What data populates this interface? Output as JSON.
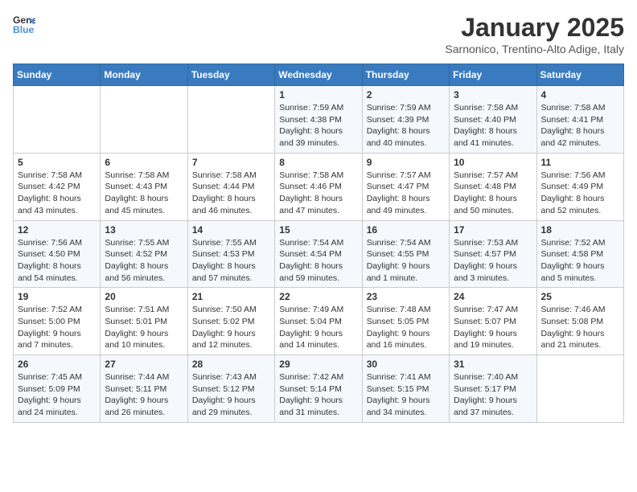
{
  "header": {
    "logo_line1": "General",
    "logo_line2": "Blue",
    "month": "January 2025",
    "location": "Sarnonico, Trentino-Alto Adige, Italy"
  },
  "days_of_week": [
    "Sunday",
    "Monday",
    "Tuesday",
    "Wednesday",
    "Thursday",
    "Friday",
    "Saturday"
  ],
  "weeks": [
    [
      {
        "day": "",
        "info": ""
      },
      {
        "day": "",
        "info": ""
      },
      {
        "day": "",
        "info": ""
      },
      {
        "day": "1",
        "info": "Sunrise: 7:59 AM\nSunset: 4:38 PM\nDaylight: 8 hours\nand 39 minutes."
      },
      {
        "day": "2",
        "info": "Sunrise: 7:59 AM\nSunset: 4:39 PM\nDaylight: 8 hours\nand 40 minutes."
      },
      {
        "day": "3",
        "info": "Sunrise: 7:58 AM\nSunset: 4:40 PM\nDaylight: 8 hours\nand 41 minutes."
      },
      {
        "day": "4",
        "info": "Sunrise: 7:58 AM\nSunset: 4:41 PM\nDaylight: 8 hours\nand 42 minutes."
      }
    ],
    [
      {
        "day": "5",
        "info": "Sunrise: 7:58 AM\nSunset: 4:42 PM\nDaylight: 8 hours\nand 43 minutes."
      },
      {
        "day": "6",
        "info": "Sunrise: 7:58 AM\nSunset: 4:43 PM\nDaylight: 8 hours\nand 45 minutes."
      },
      {
        "day": "7",
        "info": "Sunrise: 7:58 AM\nSunset: 4:44 PM\nDaylight: 8 hours\nand 46 minutes."
      },
      {
        "day": "8",
        "info": "Sunrise: 7:58 AM\nSunset: 4:46 PM\nDaylight: 8 hours\nand 47 minutes."
      },
      {
        "day": "9",
        "info": "Sunrise: 7:57 AM\nSunset: 4:47 PM\nDaylight: 8 hours\nand 49 minutes."
      },
      {
        "day": "10",
        "info": "Sunrise: 7:57 AM\nSunset: 4:48 PM\nDaylight: 8 hours\nand 50 minutes."
      },
      {
        "day": "11",
        "info": "Sunrise: 7:56 AM\nSunset: 4:49 PM\nDaylight: 8 hours\nand 52 minutes."
      }
    ],
    [
      {
        "day": "12",
        "info": "Sunrise: 7:56 AM\nSunset: 4:50 PM\nDaylight: 8 hours\nand 54 minutes."
      },
      {
        "day": "13",
        "info": "Sunrise: 7:55 AM\nSunset: 4:52 PM\nDaylight: 8 hours\nand 56 minutes."
      },
      {
        "day": "14",
        "info": "Sunrise: 7:55 AM\nSunset: 4:53 PM\nDaylight: 8 hours\nand 57 minutes."
      },
      {
        "day": "15",
        "info": "Sunrise: 7:54 AM\nSunset: 4:54 PM\nDaylight: 8 hours\nand 59 minutes."
      },
      {
        "day": "16",
        "info": "Sunrise: 7:54 AM\nSunset: 4:55 PM\nDaylight: 9 hours\nand 1 minute."
      },
      {
        "day": "17",
        "info": "Sunrise: 7:53 AM\nSunset: 4:57 PM\nDaylight: 9 hours\nand 3 minutes."
      },
      {
        "day": "18",
        "info": "Sunrise: 7:52 AM\nSunset: 4:58 PM\nDaylight: 9 hours\nand 5 minutes."
      }
    ],
    [
      {
        "day": "19",
        "info": "Sunrise: 7:52 AM\nSunset: 5:00 PM\nDaylight: 9 hours\nand 7 minutes."
      },
      {
        "day": "20",
        "info": "Sunrise: 7:51 AM\nSunset: 5:01 PM\nDaylight: 9 hours\nand 10 minutes."
      },
      {
        "day": "21",
        "info": "Sunrise: 7:50 AM\nSunset: 5:02 PM\nDaylight: 9 hours\nand 12 minutes."
      },
      {
        "day": "22",
        "info": "Sunrise: 7:49 AM\nSunset: 5:04 PM\nDaylight: 9 hours\nand 14 minutes."
      },
      {
        "day": "23",
        "info": "Sunrise: 7:48 AM\nSunset: 5:05 PM\nDaylight: 9 hours\nand 16 minutes."
      },
      {
        "day": "24",
        "info": "Sunrise: 7:47 AM\nSunset: 5:07 PM\nDaylight: 9 hours\nand 19 minutes."
      },
      {
        "day": "25",
        "info": "Sunrise: 7:46 AM\nSunset: 5:08 PM\nDaylight: 9 hours\nand 21 minutes."
      }
    ],
    [
      {
        "day": "26",
        "info": "Sunrise: 7:45 AM\nSunset: 5:09 PM\nDaylight: 9 hours\nand 24 minutes."
      },
      {
        "day": "27",
        "info": "Sunrise: 7:44 AM\nSunset: 5:11 PM\nDaylight: 9 hours\nand 26 minutes."
      },
      {
        "day": "28",
        "info": "Sunrise: 7:43 AM\nSunset: 5:12 PM\nDaylight: 9 hours\nand 29 minutes."
      },
      {
        "day": "29",
        "info": "Sunrise: 7:42 AM\nSunset: 5:14 PM\nDaylight: 9 hours\nand 31 minutes."
      },
      {
        "day": "30",
        "info": "Sunrise: 7:41 AM\nSunset: 5:15 PM\nDaylight: 9 hours\nand 34 minutes."
      },
      {
        "day": "31",
        "info": "Sunrise: 7:40 AM\nSunset: 5:17 PM\nDaylight: 9 hours\nand 37 minutes."
      },
      {
        "day": "",
        "info": ""
      }
    ]
  ]
}
